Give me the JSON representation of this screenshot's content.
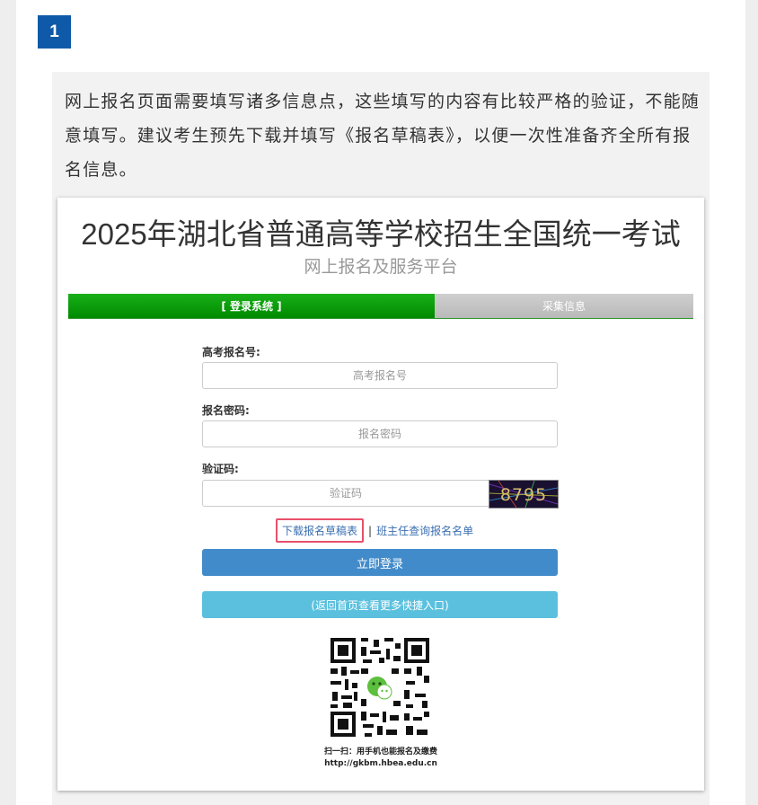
{
  "step": {
    "number": "1"
  },
  "intro": {
    "text": "网上报名页面需要填写诸多信息点，这些填写的内容有比较严格的验证，不能随意填写。建议考生预先下载并填写《报名草稿表》，以便一次性准备齐全所有报名信息。"
  },
  "portal": {
    "title": "2025年湖北省普通高等学校招生全国统一考试",
    "subtitle": "网上报名及服务平台",
    "progress": {
      "active_label": "[ 登录系统 ]",
      "next_label": "采集信息"
    },
    "form": {
      "exam_number_label": "高考报名号:",
      "exam_number_placeholder": "高考报名号",
      "exam_number_value": "",
      "password_label": "报名密码:",
      "password_placeholder": "报名密码",
      "password_value": "",
      "captcha_label": "验证码:",
      "captcha_placeholder": "验证码",
      "captcha_value": "",
      "captcha_image_text": "8795"
    },
    "links": {
      "download_draft": "下载报名草稿表",
      "separator": "|",
      "teacher_query": "班主任查询报名名单"
    },
    "buttons": {
      "login": "立即登录",
      "return_home": "(返回首页查看更多快捷入口)"
    },
    "qr": {
      "caption": "扫一扫：用手机也能报名及缴费",
      "url": "http://gkbm.hbea.edu.cn"
    }
  },
  "colors": {
    "badge": "#0f5aa8",
    "progress_active": "#008a00",
    "progress_inactive": "#c4c4c4",
    "login_button": "#428bca",
    "return_button": "#5bc0de",
    "link": "#3a6fb0",
    "highlight_border": "#e8506a"
  },
  "icons": {
    "captcha": "captcha-image",
    "qr_code": "qr-code-icon",
    "wechat": "wechat-icon"
  }
}
